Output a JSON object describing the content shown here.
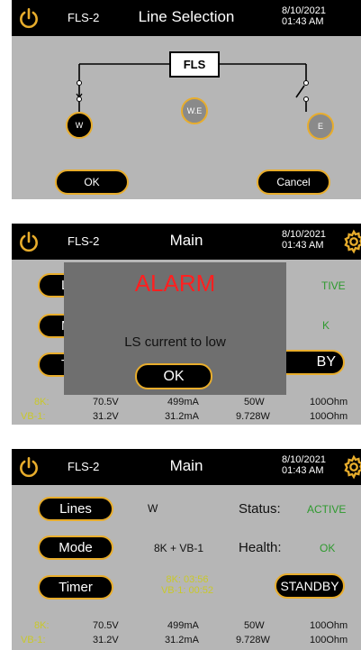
{
  "common": {
    "device": "FLS-2",
    "date": "8/10/2021",
    "time": "01:43 AM"
  },
  "panel1": {
    "title": "Line Selection",
    "fls_label": "FLS",
    "w_label": "W",
    "we_label": "W.E",
    "e_label": "E",
    "ok": "OK",
    "cancel": "Cancel"
  },
  "panel2": {
    "title": "Main",
    "btn1_partial": "L",
    "btn2_partial": "M",
    "btn3_partial": "T",
    "status_partial": "TIVE",
    "health_partial": "K",
    "standby_partial": "BY",
    "alarm_title": "ALARM",
    "alarm_msg": "LS current to low",
    "alarm_ok": "OK",
    "row1": {
      "label": "8K:",
      "v": "70.5V",
      "i": "499mA",
      "p": "50W",
      "r": "100Ohm"
    },
    "row2": {
      "label": "VB-1:",
      "v": "31.2V",
      "i": "31.2mA",
      "p": "9.728W",
      "r": "100Ohm"
    }
  },
  "panel3": {
    "title": "Main",
    "lines_btn": "Lines",
    "lines_value": "W",
    "mode_btn": "Mode",
    "mode_value": "8K + VB-1",
    "timer_btn": "Timer",
    "timer_8k": "8K: 03:56",
    "timer_vb": "VB-1:  00:52",
    "status_label": "Status:",
    "status_value": "ACTIVE",
    "health_label": "Health:",
    "health_value": "OK",
    "standby_btn": "STANDBY",
    "row1": {
      "label": "8K:",
      "v": "70.5V",
      "i": "499mA",
      "p": "50W",
      "r": "100Ohm"
    },
    "row2": {
      "label": "VB-1:",
      "v": "31.2V",
      "i": "31.2mA",
      "p": "9.728W",
      "r": "100Ohm"
    }
  },
  "colors": {
    "accent": "#e8ad2c",
    "active": "#2e9a2e",
    "alarm": "#ff2020"
  }
}
